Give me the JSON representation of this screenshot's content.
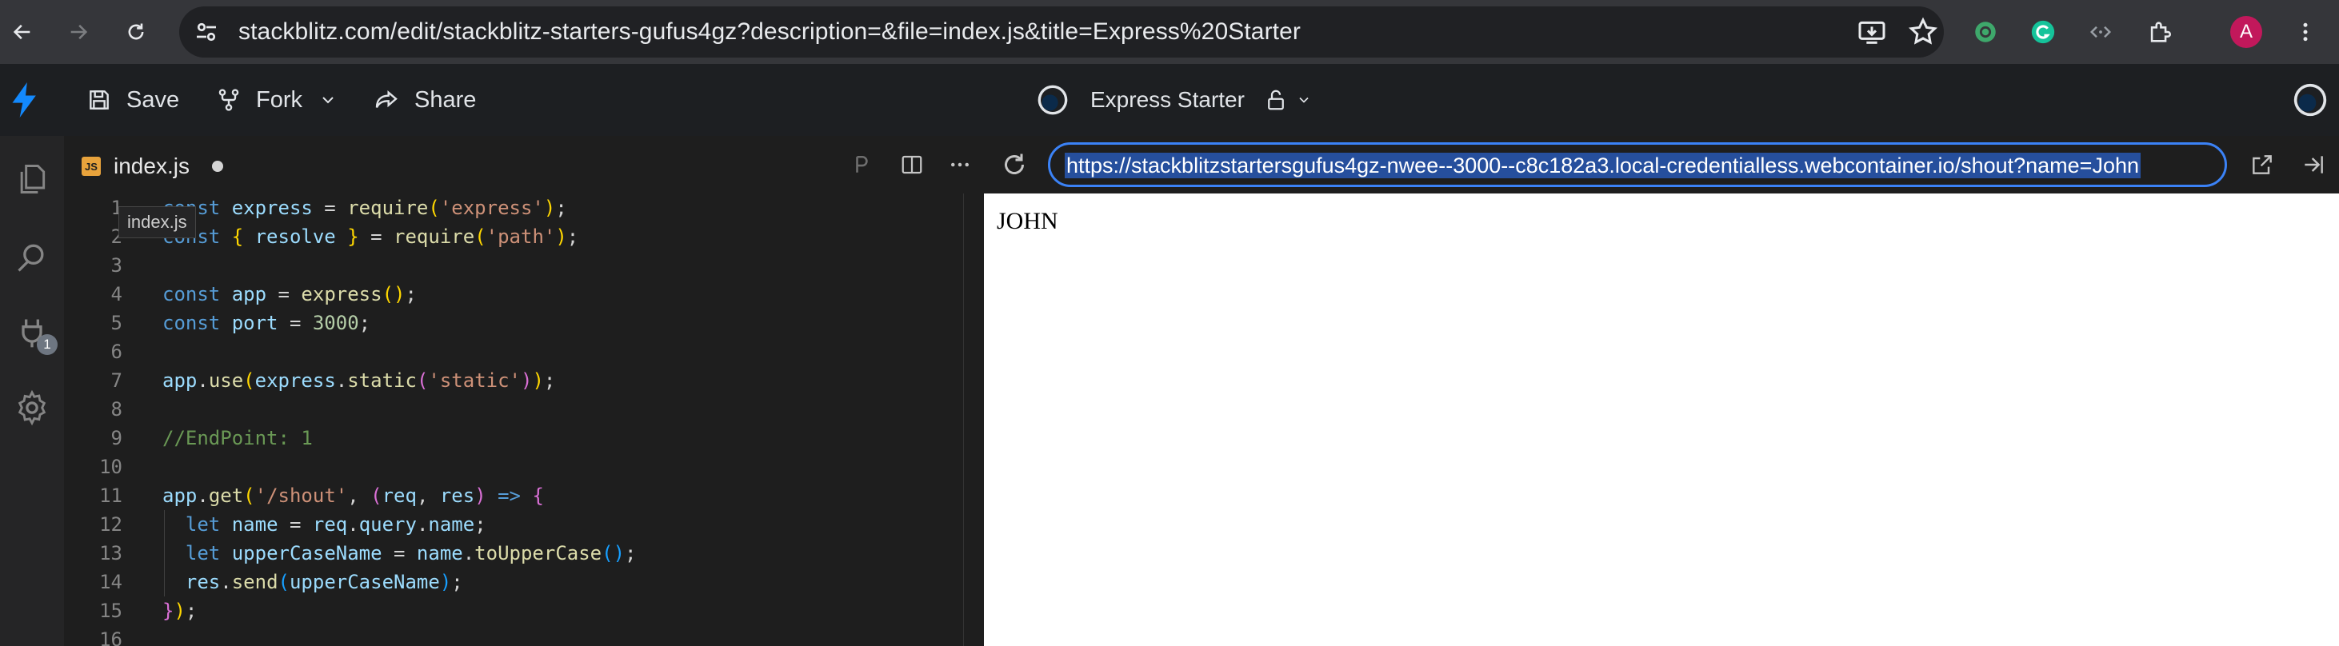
{
  "browser": {
    "url": "stackblitz.com/edit/stackblitz-starters-gufus4gz?description=&file=index.js&title=Express%20Starter",
    "avatar_initial": "A"
  },
  "header": {
    "save_label": "Save",
    "fork_label": "Fork",
    "share_label": "Share",
    "project_title": "Express Starter"
  },
  "activity": {
    "badge_count": "1"
  },
  "editor": {
    "tab_label": "index.js",
    "tooltip": "index.js",
    "lines": [
      {
        "n": "1"
      },
      {
        "n": "2"
      },
      {
        "n": "3"
      },
      {
        "n": "4"
      },
      {
        "n": "5"
      },
      {
        "n": "6"
      },
      {
        "n": "7"
      },
      {
        "n": "8"
      },
      {
        "n": "9"
      },
      {
        "n": "10"
      },
      {
        "n": "11"
      },
      {
        "n": "12"
      },
      {
        "n": "13"
      },
      {
        "n": "14"
      },
      {
        "n": "15"
      },
      {
        "n": "16"
      }
    ],
    "code": {
      "l1_kw": "const",
      "l1_var": "express",
      "l1_eq": " = ",
      "l1_fn": "require",
      "l1_str": "'express'",
      "l2_kw": "const",
      "l2_var": "resolve",
      "l2_fn": "require",
      "l2_str": "'path'",
      "l4_kw": "const",
      "l4_var": "app",
      "l4_fn": "express",
      "l5_kw": "const",
      "l5_var": "port",
      "l5_num": "3000",
      "l7_var": "app",
      "l7_fn": "use",
      "l7_var2": "express",
      "l7_fn2": "static",
      "l7_str": "'static'",
      "l9_com": "//EndPoint: 1",
      "l11_var": "app",
      "l11_fn": "get",
      "l11_str": "'/shout'",
      "l11_p1": "req",
      "l11_p2": "res",
      "l11_arrow": "=>",
      "l12_kw": "let",
      "l12_var": "name",
      "l12_var2": "req",
      "l12_var3": "query",
      "l12_var4": "name",
      "l13_kw": "let",
      "l13_var": "upperCaseName",
      "l13_var2": "name",
      "l13_fn": "toUpperCase",
      "l14_var": "res",
      "l14_fn": "send",
      "l14_var2": "upperCaseName"
    }
  },
  "preview": {
    "url": "https://stackblitzstartersgufus4gz-nwee--3000--c8c182a3.local-credentialless.webcontainer.io/shout?name=John",
    "output": "JOHN"
  },
  "colors": {
    "accent": "#3b82f6",
    "keyword": "#569cd6",
    "string": "#ce9178",
    "function": "#dcdcaa",
    "comment": "#6a9955"
  }
}
